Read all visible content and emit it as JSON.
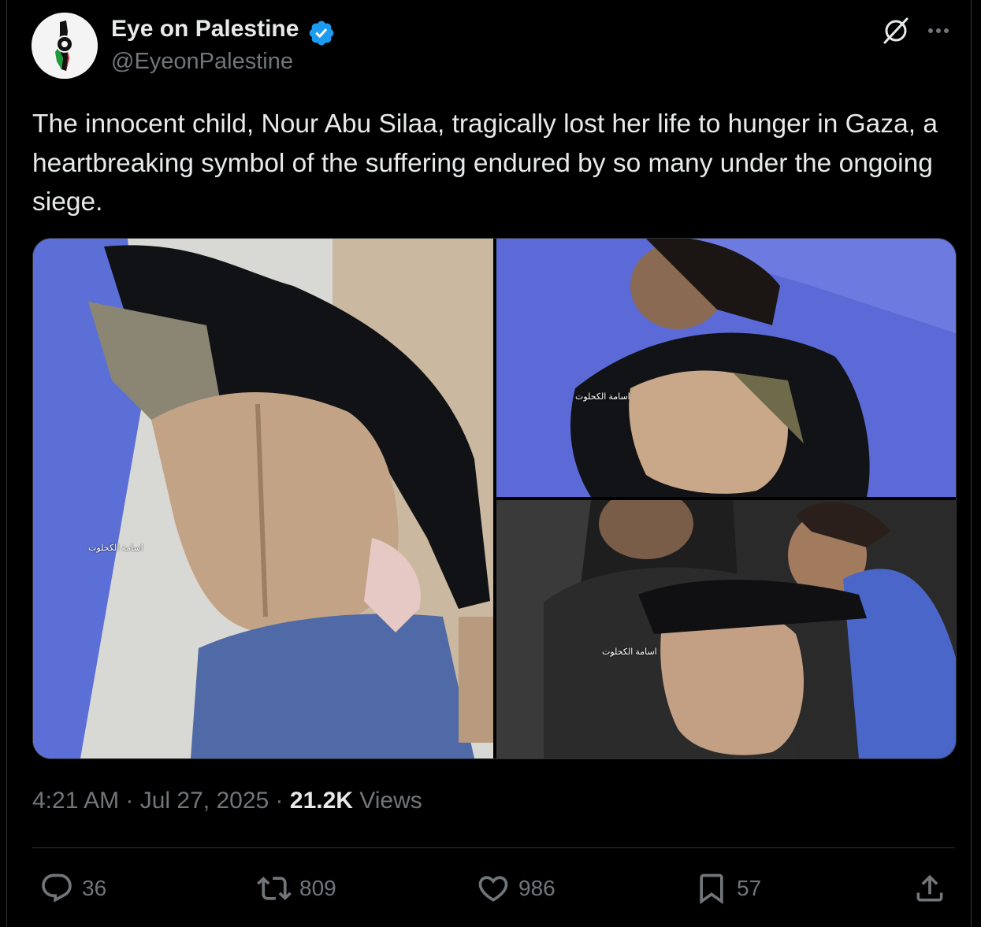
{
  "author": {
    "display_name": "Eye on Palestine",
    "handle": "@EyeonPalestine",
    "verified": true,
    "avatar_icon": "palestine-map-eye-logo"
  },
  "header_actions": {
    "grok_icon": "grok-icon",
    "more_icon": "more-horizontal-icon"
  },
  "tweet": {
    "text": "The innocent child, Nour Abu Silaa, tragically lost her life to hunger in Gaza, a heartbreaking symbol of the suffering endured by so many under the ongoing siege."
  },
  "media": {
    "photos": [
      {
        "watermark": "اسامة الكحلوت"
      },
      {
        "watermark": "اسامة الكحلوت"
      },
      {
        "watermark": "اسامة الكحلوت"
      }
    ]
  },
  "meta": {
    "time": "4:21 AM",
    "separator": " · ",
    "date": "Jul 27, 2025",
    "views_count": "21.2K",
    "views_label": " Views"
  },
  "actions": {
    "replies": "36",
    "reposts": "809",
    "likes": "986",
    "bookmarks": "57"
  },
  "colors": {
    "background": "#000000",
    "text": "#e7e9ea",
    "muted": "#71767b",
    "border": "#2f3336",
    "verified_blue": "#1d9bf0"
  }
}
